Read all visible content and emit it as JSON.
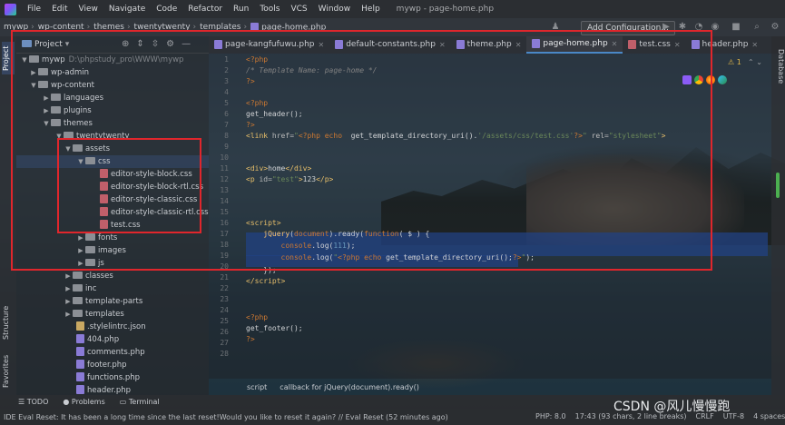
{
  "app": {
    "menu": [
      "File",
      "Edit",
      "View",
      "Navigate",
      "Code",
      "Refactor",
      "Run",
      "Tools",
      "VCS",
      "Window",
      "Help"
    ],
    "window_title": "mywp - page-home.php"
  },
  "breadcrumb": [
    "mywp",
    "wp-content",
    "themes",
    "twentytwenty",
    "templates",
    "page-home.php"
  ],
  "toolbar": {
    "add_config": "Add Configuration..."
  },
  "project_panel": {
    "title": "Project",
    "root_name": "mywp",
    "root_path": "D:\\phpstudy_pro\\WWW\\mywp",
    "items": [
      {
        "label": "wp-admin"
      },
      {
        "label": "wp-content"
      },
      {
        "label": "languages"
      },
      {
        "label": "plugins"
      },
      {
        "label": "themes"
      },
      {
        "label": "twentytwenty"
      },
      {
        "label": "assets"
      },
      {
        "label": "css"
      },
      {
        "label": "editor-style-block.css"
      },
      {
        "label": "editor-style-block-rtl.css"
      },
      {
        "label": "editor-style-classic.css"
      },
      {
        "label": "editor-style-classic-rtl.css"
      },
      {
        "label": "test.css"
      },
      {
        "label": "fonts"
      },
      {
        "label": "images"
      },
      {
        "label": "js"
      },
      {
        "label": "classes"
      },
      {
        "label": "inc"
      },
      {
        "label": "template-parts"
      },
      {
        "label": "templates"
      },
      {
        "label": ".stylelintrc.json"
      },
      {
        "label": "404.php"
      },
      {
        "label": "comments.php"
      },
      {
        "label": "footer.php"
      },
      {
        "label": "functions.php"
      },
      {
        "label": "header.php"
      }
    ]
  },
  "editor": {
    "tabs": [
      {
        "label": "page-kangfufuwu.php"
      },
      {
        "label": "default-constants.php"
      },
      {
        "label": "theme.php"
      },
      {
        "label": "page-home.php"
      },
      {
        "label": "test.css"
      },
      {
        "label": "header.php"
      }
    ],
    "line_numbers": [
      "1",
      "2",
      "3",
      "4",
      "5",
      "6",
      "7",
      "8",
      "9",
      "10",
      "11",
      "12",
      "13",
      "14",
      "15",
      "16",
      "17",
      "18",
      "19",
      "20",
      "21",
      "22",
      "23",
      "24",
      "25",
      "26",
      "27",
      "28"
    ],
    "warnings": "1",
    "code_breadcrumb": [
      "script",
      "callback for jQuery(document).ready()"
    ]
  },
  "side_tabs": {
    "left": [
      "Project",
      "Structure",
      "Favorites"
    ],
    "right": [
      "Database"
    ]
  },
  "bottom_tools": [
    "TODO",
    "Problems",
    "Terminal"
  ],
  "status": {
    "message": "IDE Eval Reset: It has been a long time since the last reset!Would you like to reset it again? // Eval Reset (52 minutes ago)",
    "php": "PHP: 8.0",
    "position": "17:43 (93 chars, 2 line breaks)",
    "line_sep": "CRLF",
    "encoding": "UTF-8",
    "indent": "4 spaces"
  },
  "watermark": "CSDN @风儿慢慢跑",
  "colors": {
    "annotation": "#e0262c",
    "selection": "#214283",
    "accent": "#4a88c7"
  }
}
